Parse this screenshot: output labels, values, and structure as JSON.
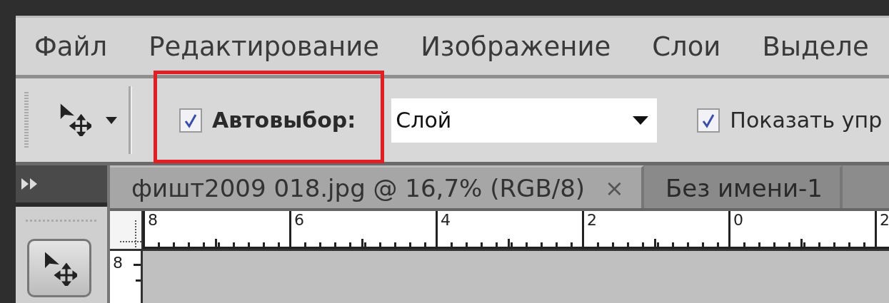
{
  "menu": [
    {
      "label": "Файл"
    },
    {
      "label": "Редактирование"
    },
    {
      "label": "Изображение"
    },
    {
      "label": "Слои"
    },
    {
      "label": "Выделе"
    }
  ],
  "options_bar": {
    "auto_select": {
      "label": "Автовыбор:",
      "checked": true
    },
    "target": {
      "value": "Слой"
    },
    "show_controls": {
      "label": "Показать упр",
      "checked": true
    }
  },
  "tools": [
    {
      "selected": true
    }
  ],
  "document_tabs": [
    {
      "title": "фишт2009 018.jpg @ 16,7% (RGB/8)",
      "close": "×",
      "selected": true
    },
    {
      "title": "Без имени-1",
      "selected": false
    }
  ],
  "ruler": {
    "horizontal": [
      "8",
      "6",
      "4",
      "2",
      "0",
      "2"
    ],
    "vertical": [
      "8"
    ]
  }
}
